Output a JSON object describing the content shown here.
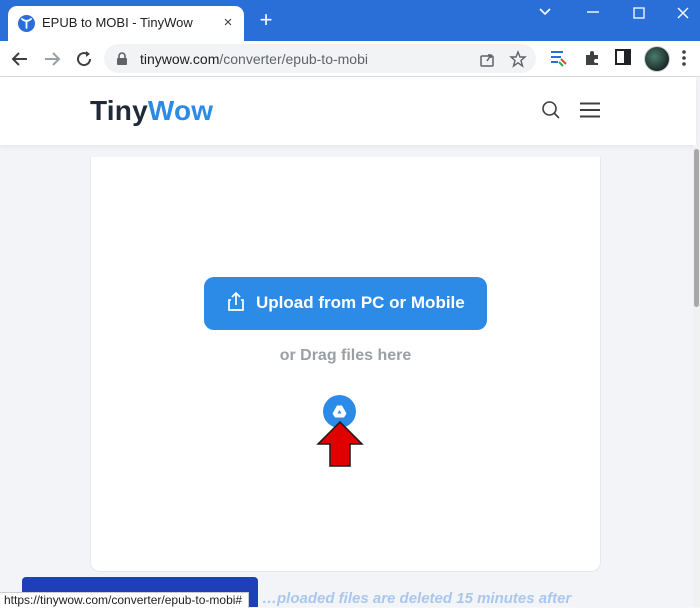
{
  "browser": {
    "tab_title": "EPUB to MOBI - TinyWow",
    "tab_close": "×",
    "new_tab": "+",
    "url_host": "tinywow.com",
    "url_path": "/converter/epub-to-mobi",
    "status_url": "https://tinywow.com/converter/epub-to-mobi#",
    "accent_color": "#2a6fd8"
  },
  "site": {
    "logo_part1": "Tiny",
    "logo_part2": "Wow",
    "brand_color": "#2b8be6"
  },
  "upload": {
    "button_label": "Upload from PC or Mobile",
    "drag_text": "or Drag files here",
    "google_drive_icon": "google-drive-icon",
    "annotation_color": "#e00000"
  },
  "footer": {
    "partial_text": "…ploaded files are deleted 15 minutes after"
  }
}
